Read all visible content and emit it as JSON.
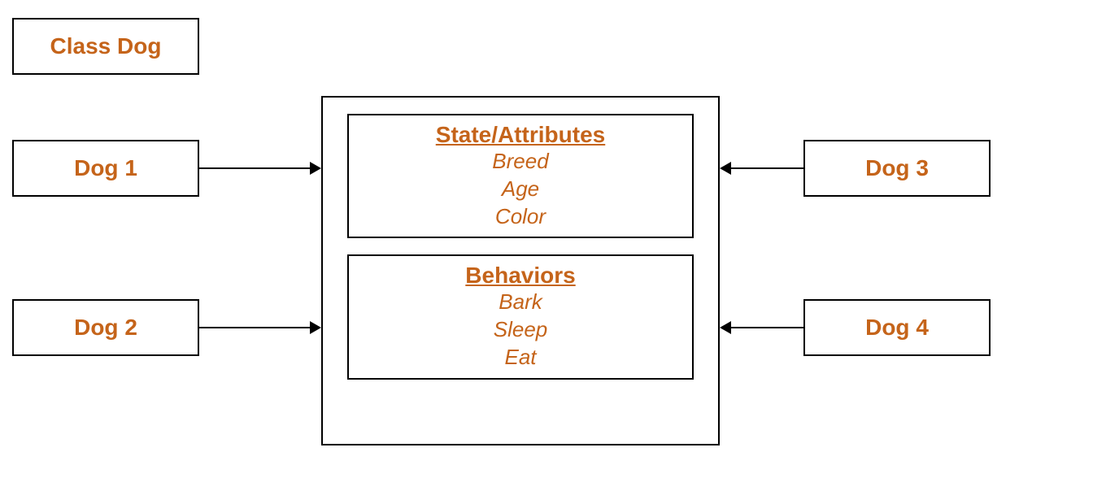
{
  "classLabel": "Class Dog",
  "instances": {
    "dog1": "Dog 1",
    "dog2": "Dog 2",
    "dog3": "Dog 3",
    "dog4": "Dog 4"
  },
  "attributes": {
    "title": "State/Attributes",
    "items": [
      "Breed",
      "Age",
      "Color"
    ]
  },
  "behaviors": {
    "title": "Behaviors",
    "items": [
      "Bark",
      "Sleep",
      "Eat"
    ]
  }
}
